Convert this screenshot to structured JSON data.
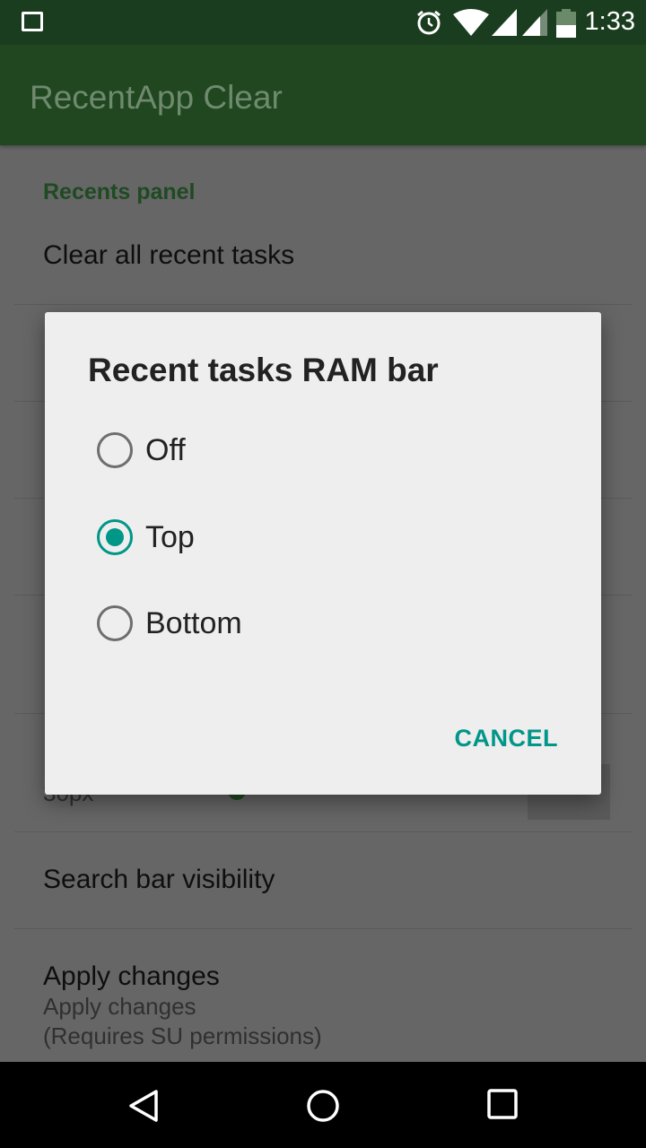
{
  "status_bar": {
    "time": "1:33",
    "battery": "45",
    "icons": [
      "image-icon",
      "alarm-icon",
      "wifi-icon",
      "signal-icon",
      "signal-icon",
      "battery-icon"
    ]
  },
  "app_bar": {
    "title": "RecentApp Clear"
  },
  "settings": {
    "category": "Recents panel",
    "items": [
      {
        "title": "Clear all recent tasks"
      },
      {
        "subtitle": "30px"
      },
      {
        "title": "Search bar visibility"
      },
      {
        "title": "Apply changes",
        "subtitle": "Apply changes",
        "subtitle2": "(Requires SU permissions)"
      }
    ]
  },
  "dialog": {
    "title": "Recent tasks RAM bar",
    "options": [
      {
        "label": "Off",
        "selected": false
      },
      {
        "label": "Top",
        "selected": true
      },
      {
        "label": "Bottom",
        "selected": false
      }
    ],
    "cancel": "CANCEL"
  },
  "colors": {
    "accent": "#009688",
    "primary": "#52b152",
    "status": "#1b3d1f"
  }
}
